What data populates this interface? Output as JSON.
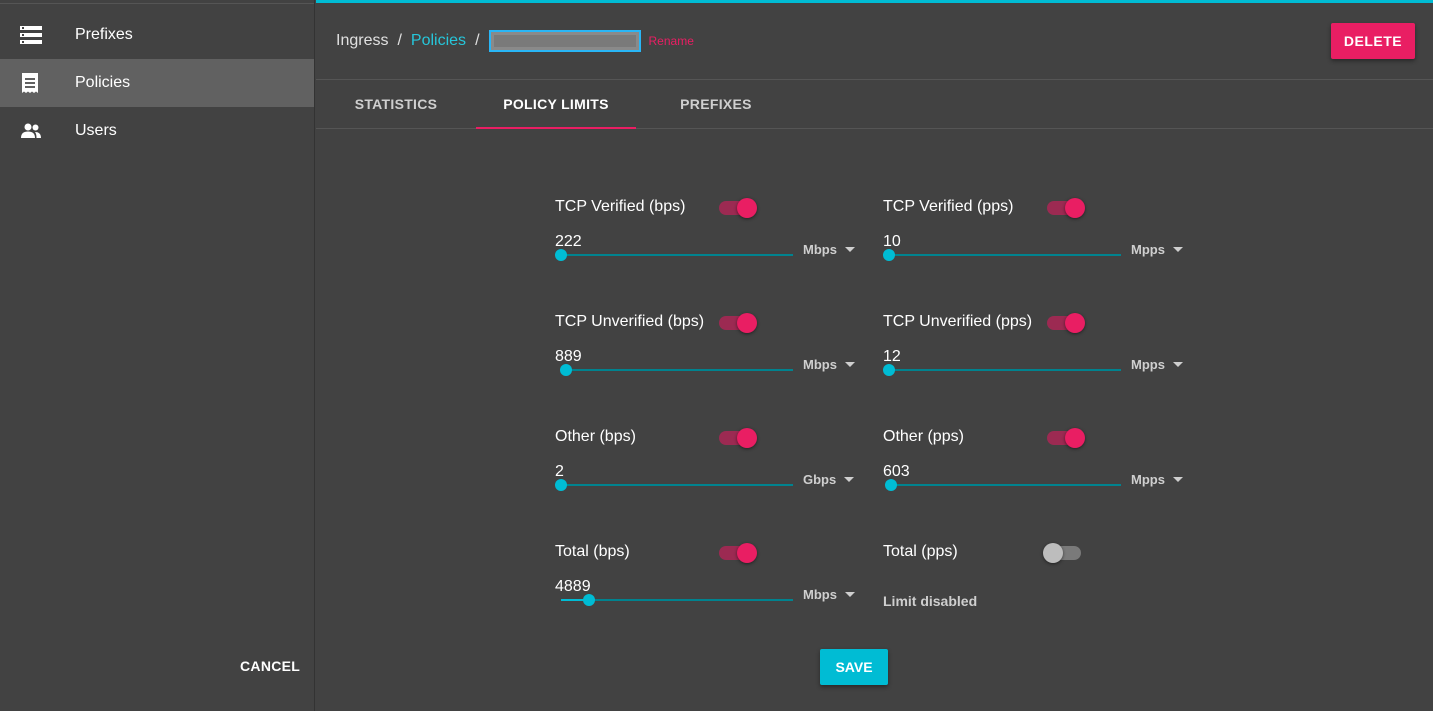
{
  "sidebar": {
    "items": [
      {
        "label": "Prefixes",
        "icon": "list-icon"
      },
      {
        "label": "Policies",
        "icon": "receipt-icon",
        "active": true
      },
      {
        "label": "Users",
        "icon": "people-icon"
      }
    ]
  },
  "header": {
    "breadcrumb_root": "Ingress",
    "breadcrumb_section": "Policies",
    "separator": "/",
    "rename_label": "Rename",
    "delete_label": "DELETE"
  },
  "tabs": [
    {
      "label": "STATISTICS"
    },
    {
      "label": "POLICY LIMITS",
      "active": true
    },
    {
      "label": "PREFIXES"
    }
  ],
  "limits": [
    {
      "title": "TCP Verified (bps)",
      "enabled": true,
      "value": "222",
      "unit": "Mbps",
      "fraction": 0.0
    },
    {
      "title": "TCP Verified (pps)",
      "enabled": true,
      "value": "10",
      "unit": "Mpps",
      "fraction": 0.0
    },
    {
      "title": "TCP Unverified (bps)",
      "enabled": true,
      "value": "889",
      "unit": "Mbps",
      "fraction": 0.02
    },
    {
      "title": "TCP Unverified (pps)",
      "enabled": true,
      "value": "12",
      "unit": "Mpps",
      "fraction": 0.0
    },
    {
      "title": "Other (bps)",
      "enabled": true,
      "value": "2",
      "unit": "Gbps",
      "fraction": 0.0
    },
    {
      "title": "Other (pps)",
      "enabled": true,
      "value": "603",
      "unit": "Mpps",
      "fraction": 0.01
    },
    {
      "title": "Total (bps)",
      "enabled": true,
      "value": "4889",
      "unit": "Mbps",
      "fraction": 0.12
    },
    {
      "title": "Total (pps)",
      "enabled": false,
      "disabled_note": "Limit disabled"
    }
  ],
  "actions": {
    "cancel_label": "CANCEL",
    "save_label": "SAVE"
  },
  "colors": {
    "accent": "#e91e63",
    "primary": "#00bcd4",
    "background": "#424242"
  }
}
